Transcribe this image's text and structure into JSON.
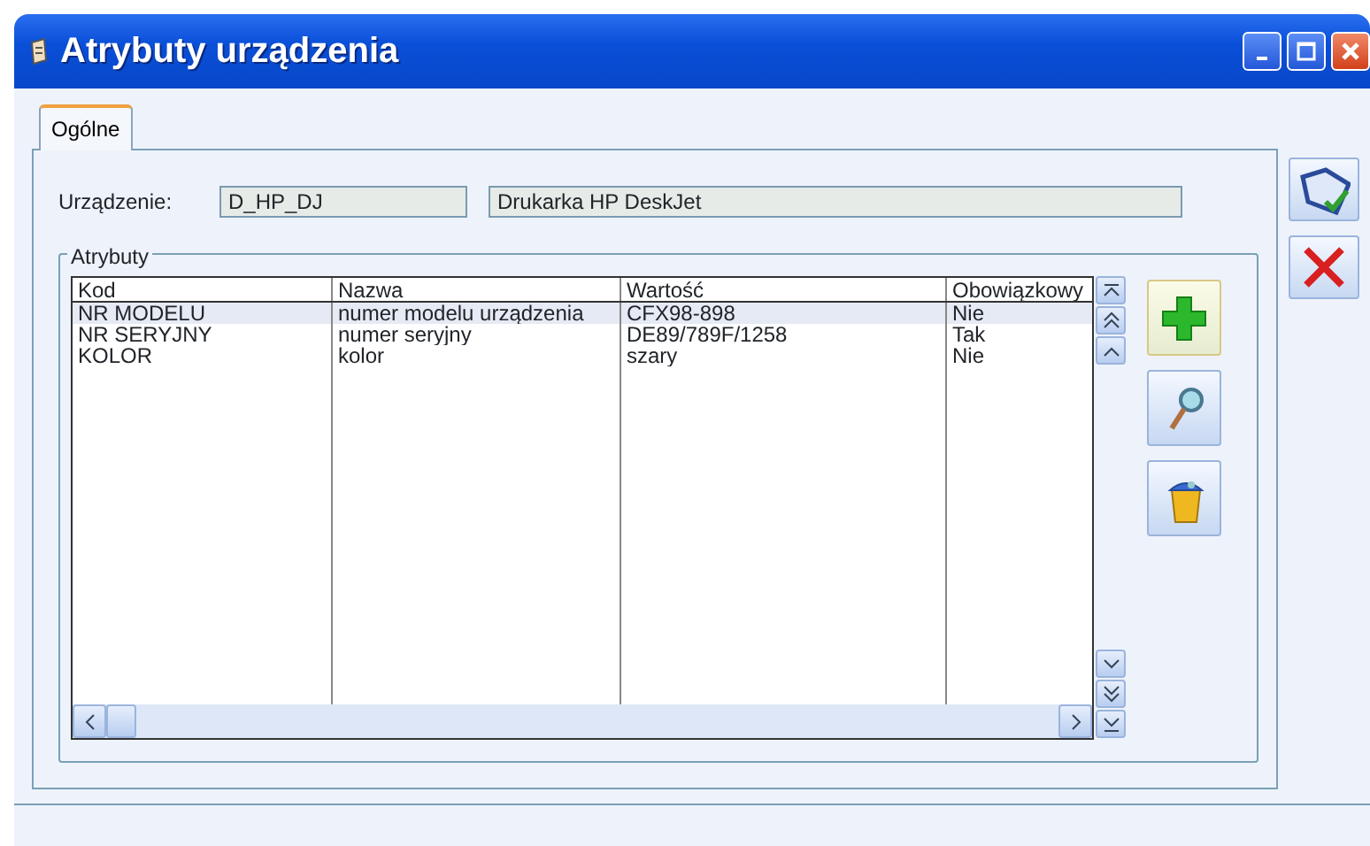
{
  "window": {
    "title": "Atrybuty urządzenia"
  },
  "tabs": [
    {
      "label": "Ogólne",
      "selected": true
    }
  ],
  "device": {
    "label": "Urządzenie:",
    "code": "D_HP_DJ",
    "name": "Drukarka HP DeskJet"
  },
  "attributes": {
    "legend": "Atrybuty",
    "columns": [
      "Kod",
      "Nazwa",
      "Wartość",
      "Obowiązkowy"
    ],
    "rows": [
      {
        "cells": [
          "NR MODELU",
          "numer modelu urządzenia",
          "CFX98-898",
          "Nie"
        ],
        "selected": true
      },
      {
        "cells": [
          "NR SERYJNY",
          "numer seryjny",
          "DE89/789F/1258",
          "Tak"
        ],
        "selected": false
      },
      {
        "cells": [
          "KOLOR",
          "kolor",
          "szary",
          "Nie"
        ],
        "selected": false
      }
    ]
  },
  "list_actions": [
    {
      "kind": "add"
    },
    {
      "kind": "edit"
    },
    {
      "kind": "delete"
    }
  ],
  "dialog_actions": [
    {
      "kind": "save"
    },
    {
      "kind": "cancel"
    }
  ]
}
